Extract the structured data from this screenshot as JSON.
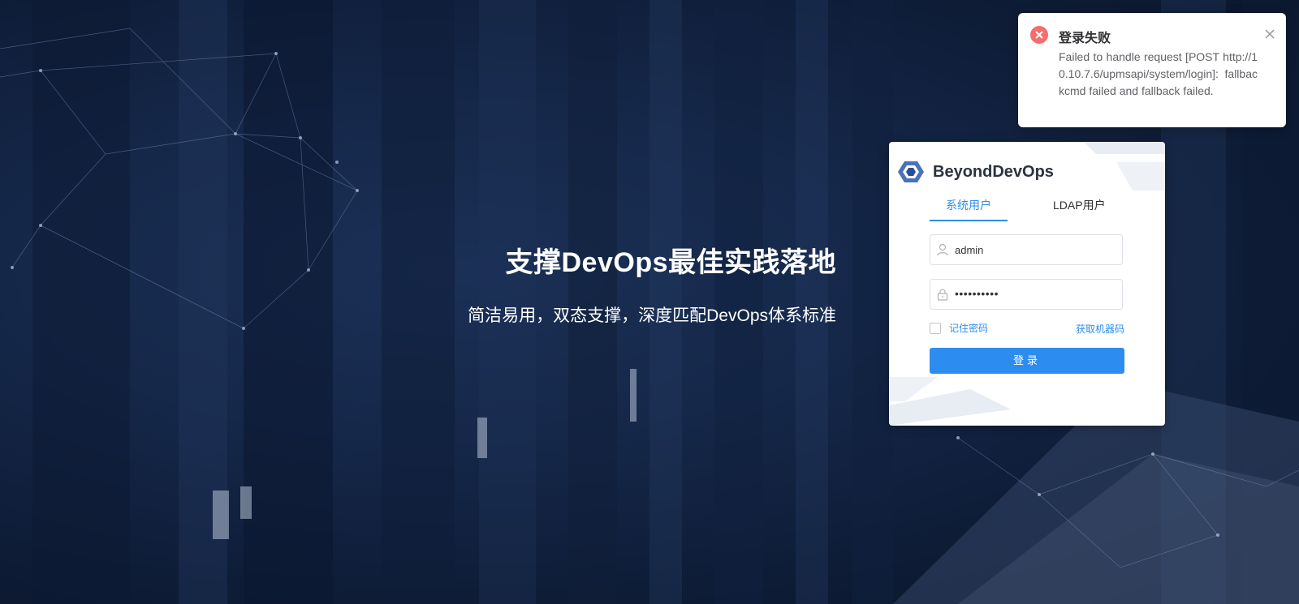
{
  "hero": {
    "title": "支撑DevOps最佳实践落地",
    "subtitle": "简洁易用，双态支撑，深度匹配DevOps体系标准"
  },
  "login": {
    "brand": "BeyondDevOps",
    "tabs": [
      {
        "label": "系统用户",
        "active": true
      },
      {
        "label": "LDAP用户",
        "active": false
      }
    ],
    "username": "admin",
    "password_mask": "••••••••••",
    "remember_label": "记住密码",
    "remember_checked": false,
    "machine_code_link": "获取机器码",
    "submit_label": "登录"
  },
  "notification": {
    "type": "error",
    "title": "登录失败",
    "message": "Failed to handle request [POST http://10.10.7.6/upmsapi/system/login]: fallbackcmd failed and fallback failed."
  },
  "colors": {
    "accent": "#2d8cf0",
    "error": "#f56c6c",
    "background": "#15284a"
  },
  "icons": {
    "user": "user-icon",
    "lock": "lock-icon",
    "error": "error-circle-icon",
    "close": "close-icon",
    "logo": "beyond-devops-logo"
  }
}
